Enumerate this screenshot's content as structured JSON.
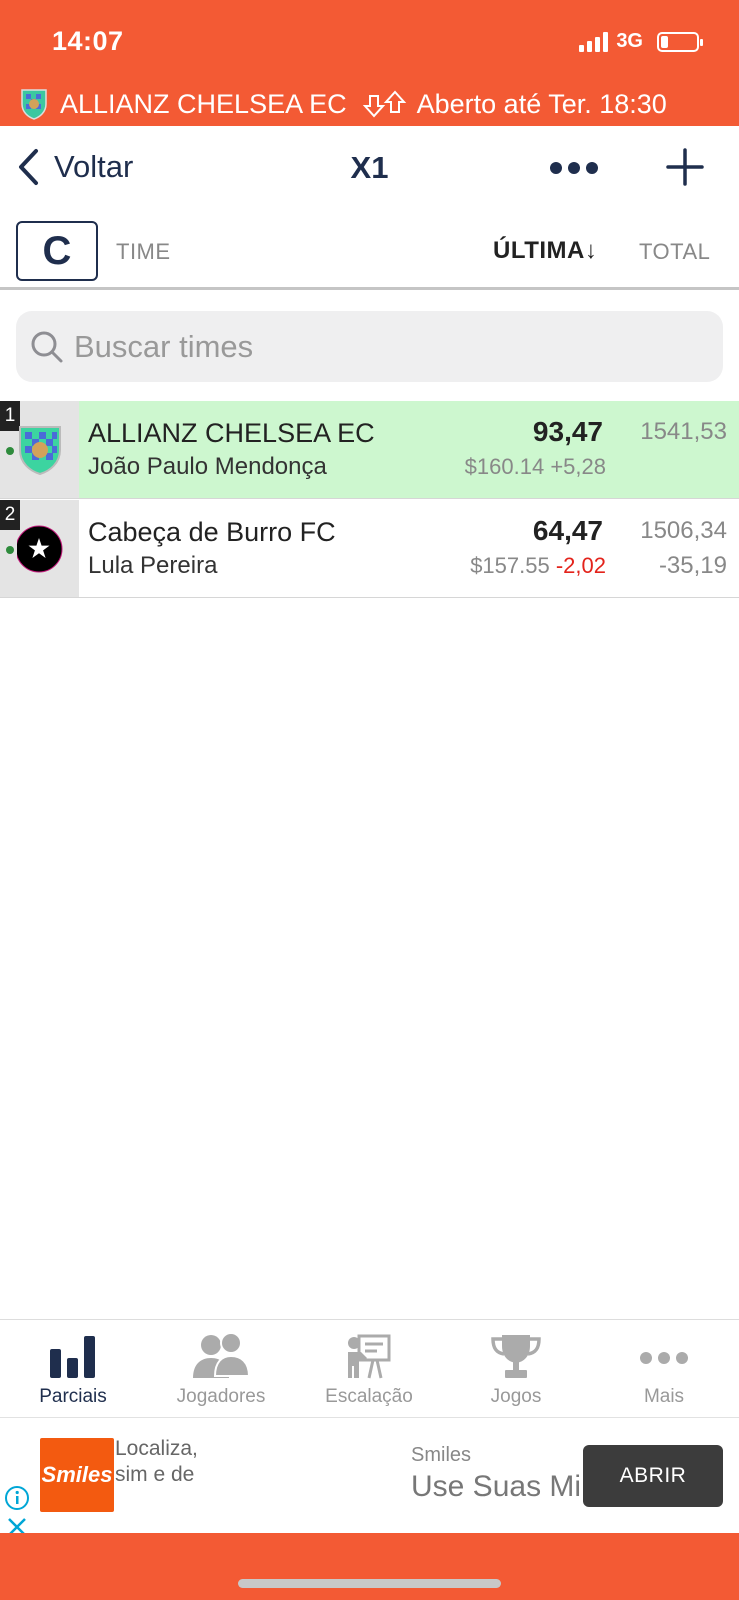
{
  "status_bar": {
    "time": "14:07",
    "network": "3G",
    "battery_level": 0.2
  },
  "banner": {
    "team": "ALLIANZ CHELSEA EC",
    "status": "Aberto até Ter. 18:30"
  },
  "nav": {
    "back_label": "Voltar",
    "title": "X1"
  },
  "columns": {
    "c_label": "C",
    "time": "TIME",
    "ultima": "ÚLTIMA↓",
    "total": "TOTAL"
  },
  "search": {
    "placeholder": "Buscar times"
  },
  "teams": [
    {
      "rank": "1",
      "name": "ALLIANZ CHELSEA EC",
      "owner": "João Paulo Mendonça",
      "score": "93,47",
      "money": "$160.14",
      "variation": "+5,28",
      "total": "1541,53",
      "total_variation": ""
    },
    {
      "rank": "2",
      "name": "Cabeça de Burro FC",
      "owner": "Lula Pereira",
      "score": "64,47",
      "money": "$157.55",
      "variation": "-2,02",
      "total": "1506,34",
      "total_variation": "-35,19"
    }
  ],
  "tabs": [
    {
      "label": "Parciais",
      "icon": "bar-chart-icon",
      "active": true
    },
    {
      "label": "Jogadores",
      "icon": "players-icon",
      "active": false
    },
    {
      "label": "Escalação",
      "icon": "lineup-board-icon",
      "active": false
    },
    {
      "label": "Jogos",
      "icon": "trophy-icon",
      "active": false
    },
    {
      "label": "Mais",
      "icon": "more-dots-icon",
      "active": false
    }
  ],
  "ad": {
    "logo_text": "Smiles",
    "text_line1": "Localiza,",
    "text_line2": "sim e de",
    "brand": "Smiles",
    "headline": "Use Suas Mi",
    "button": "ABRIR"
  },
  "colors": {
    "brand": "#f35a34",
    "navy": "#1f2e4d",
    "highlight_row": "#cdf7cf",
    "negative": "#e3231b"
  }
}
